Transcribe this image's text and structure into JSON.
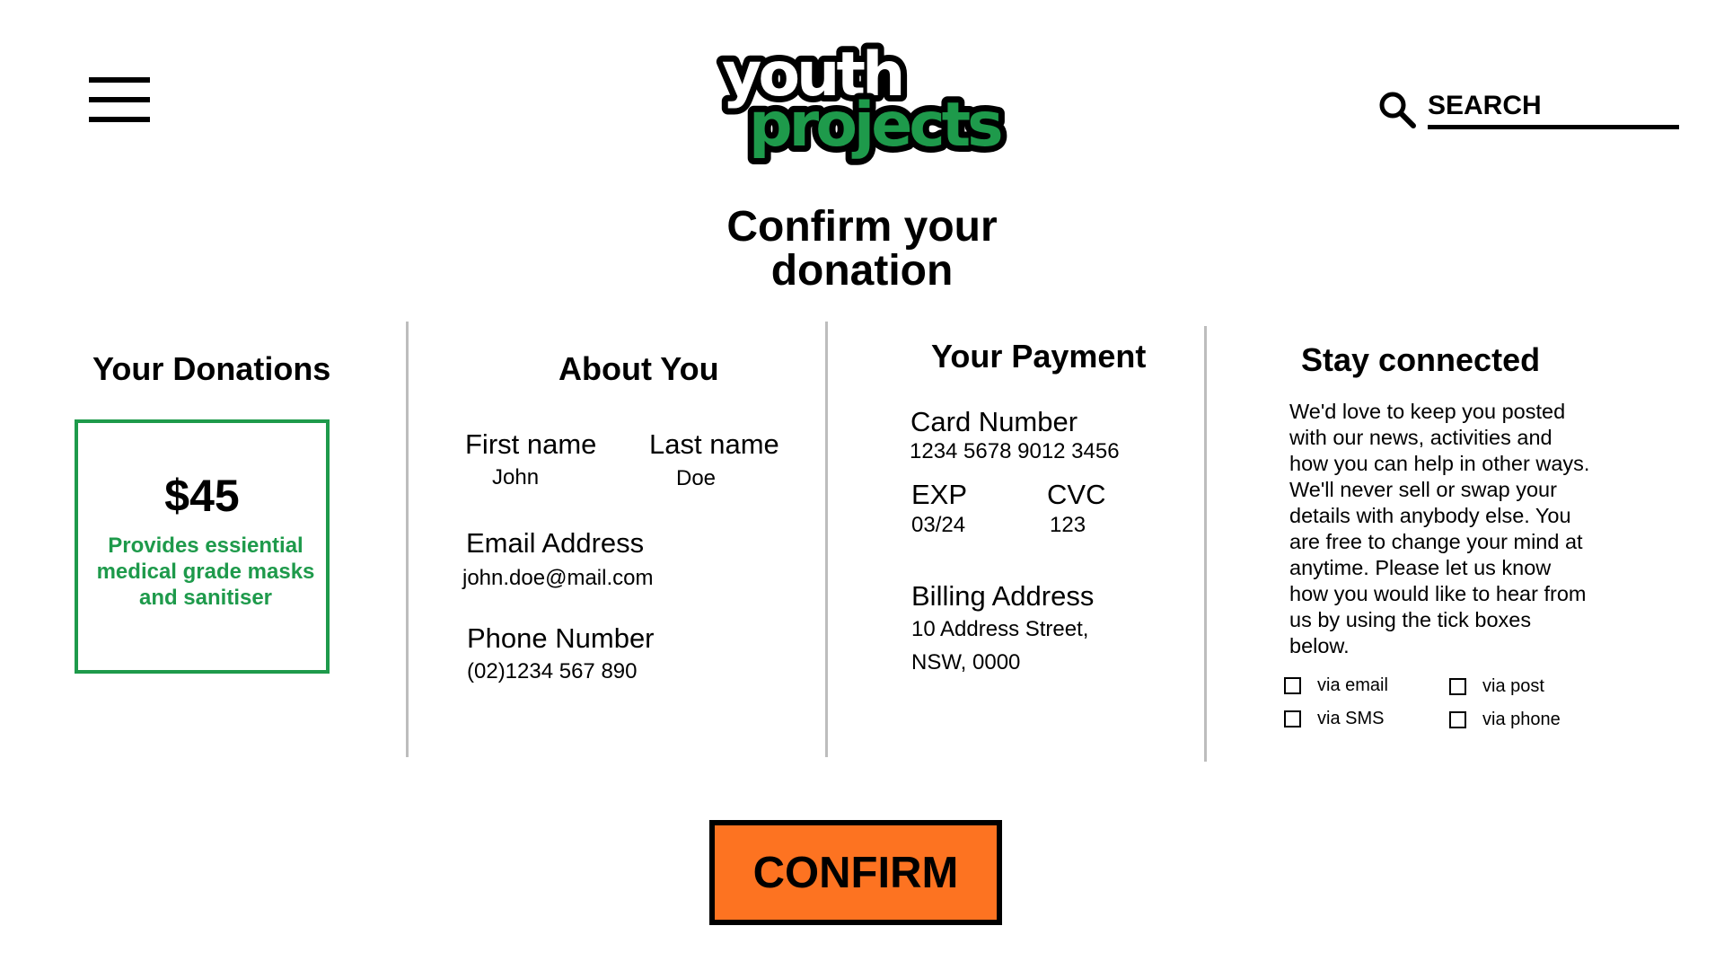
{
  "header": {
    "menu_icon": "hamburger-menu-icon",
    "logo": {
      "line1": "youth",
      "line2": "projects",
      "line1_color": "#ffffff",
      "line2_color": "#1e9a4b"
    },
    "search": {
      "icon": "search-icon",
      "placeholder": "SEARCH"
    }
  },
  "page_title": {
    "line1": "Confirm your",
    "line2": "donation"
  },
  "donations": {
    "title": "Your Donations",
    "amount": "$45",
    "description": "Provides essiential medical grade masks and sanitiser",
    "accent_color": "#1e9a4b"
  },
  "about": {
    "title": "About You",
    "first_name_label": "First name",
    "first_name": "John",
    "last_name_label": "Last name",
    "last_name": "Doe",
    "email_label": "Email Address",
    "email": "john.doe@mail.com",
    "phone_label": "Phone Number",
    "phone": "(02)1234 567 890"
  },
  "payment": {
    "title": "Your Payment",
    "card_label": "Card Number",
    "card_number": "1234 5678 9012 3456",
    "exp_label": "EXP",
    "exp": "03/24",
    "cvc_label": "CVC",
    "cvc": "123",
    "billing_label": "Billing Address",
    "billing_line1": "10 Address Street,",
    "billing_line2": "NSW, 0000"
  },
  "connected": {
    "title": "Stay connected",
    "text": "We'd love to keep you posted with our news, activities and how you can help in other ways. We'll never sell or swap your details with anybody else. You are free to change your mind at anytime. Please let us know how you would like to hear from us by using the tick boxes below.",
    "options": [
      {
        "label": "via email",
        "checked": false
      },
      {
        "label": "via post",
        "checked": false
      },
      {
        "label": "via SMS",
        "checked": false
      },
      {
        "label": "via phone",
        "checked": false
      }
    ]
  },
  "confirm": {
    "label": "CONFIRM",
    "color": "#fd7321"
  }
}
